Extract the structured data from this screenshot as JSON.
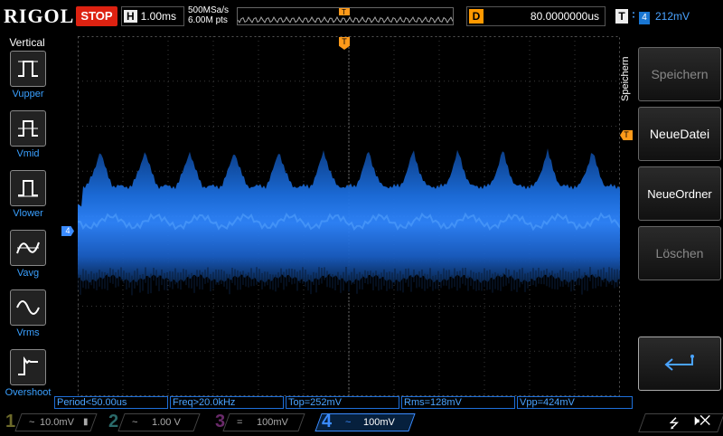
{
  "topbar": {
    "brand": "RIGOL",
    "run_state": "STOP",
    "h_label": "H",
    "timebase": "1.00ms",
    "sample_rate": "500MSa/s",
    "memory_depth": "6.00M pts",
    "delay_label": "D",
    "delay_value": "80.0000000us",
    "trigger_label": "T",
    "trigger_source": "4",
    "trigger_level": "212mV"
  },
  "left_menu": {
    "title": "Vertical",
    "items": [
      {
        "label": "Vupper",
        "icon": "vupper-icon"
      },
      {
        "label": "Vmid",
        "icon": "vmid-icon"
      },
      {
        "label": "Vlower",
        "icon": "vlower-icon"
      },
      {
        "label": "Vavg",
        "icon": "vavg-icon"
      },
      {
        "label": "Vrms",
        "icon": "vrms-icon"
      },
      {
        "label": "Overshoot",
        "icon": "overshoot-icon"
      }
    ]
  },
  "right_menu": {
    "title": "Speichern",
    "items": [
      {
        "label": "Speichern",
        "state": "disabled"
      },
      {
        "label": "NeueDatei",
        "state": "enabled"
      },
      {
        "label": "NeueOrdner",
        "state": "enabled"
      },
      {
        "label": "Löschen",
        "state": "disabled"
      },
      {
        "label": "",
        "icon": "return-arrow-icon",
        "state": "selected"
      }
    ]
  },
  "markers": {
    "trigger_position": "T",
    "channel_marker": "4"
  },
  "measurements": [
    {
      "label": "Period<50.00us"
    },
    {
      "label": "Freq>20.0kHz"
    },
    {
      "label": "Top=252mV"
    },
    {
      "label": "Rms=128mV"
    },
    {
      "label": "Vpp=424mV"
    }
  ],
  "channels": [
    {
      "num": "1",
      "coupling": "~",
      "scale": "10.0mV",
      "color": "#f5e14a",
      "active": false
    },
    {
      "num": "2",
      "coupling": "~",
      "scale": "1.00 V",
      "color": "#39d0d0",
      "active": false
    },
    {
      "num": "3",
      "coupling": "=",
      "scale": "100mV",
      "color": "#e060e0",
      "active": false
    },
    {
      "num": "4",
      "coupling": "~",
      "scale": "100mV",
      "color": "#3a8bff",
      "active": true
    }
  ],
  "colors": {
    "accent_blue": "#3a8bff",
    "trigger_orange": "#ff9a1a",
    "stop_red": "#d21f1f"
  }
}
